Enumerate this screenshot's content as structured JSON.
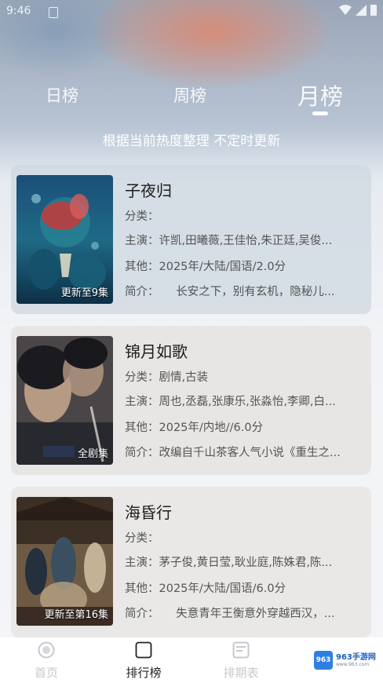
{
  "status_bar": {
    "time": "9:46"
  },
  "tabs": [
    {
      "label": "日榜"
    },
    {
      "label": "周榜"
    },
    {
      "label": "月榜",
      "active": true
    }
  ],
  "subtitle": "根据当前热度整理 不定时更新",
  "items": [
    {
      "title": "子夜归",
      "badge": "更新至9集",
      "category": "分类：",
      "cast": "主演：许凯,田曦薇,王佳怡,朱正廷,吴俊...",
      "other": "其他：2025年/大陆/国语/2.0分",
      "intro": "简介：　　长安之下，别有玄机，隐秘儿..."
    },
    {
      "title": "锦月如歌",
      "badge": "全剧集",
      "category": "分类：剧情,古装",
      "cast": "主演：周也,丞磊,张康乐,张淼怡,李卿,白...",
      "other": "其他：2025年/内地//6.0分",
      "intro": "简介：改编自千山茶客人气小说《重生之..."
    },
    {
      "title": "海昏行",
      "badge": "更新至第16集",
      "category": "分类：",
      "cast": "主演：茅子俊,黄日莹,耿业庭,陈姝君,陈...",
      "other": "其他：2025年/大陆/国语/6.0分",
      "intro": "简介：　　失意青年王衡意外穿越西汉，..."
    }
  ],
  "bottom_nav": [
    {
      "label": "首页",
      "icon": "home-icon"
    },
    {
      "label": "排行榜",
      "icon": "ranking-icon",
      "active": true
    },
    {
      "label": "排期表",
      "icon": "schedule-icon"
    }
  ],
  "watermark": {
    "logo": "963",
    "text": "963手游网",
    "sub": "www.963.com"
  },
  "colors": {
    "accent": "#ffffff",
    "nav_active": "#222222",
    "nav_inactive": "#c5c9ce"
  }
}
